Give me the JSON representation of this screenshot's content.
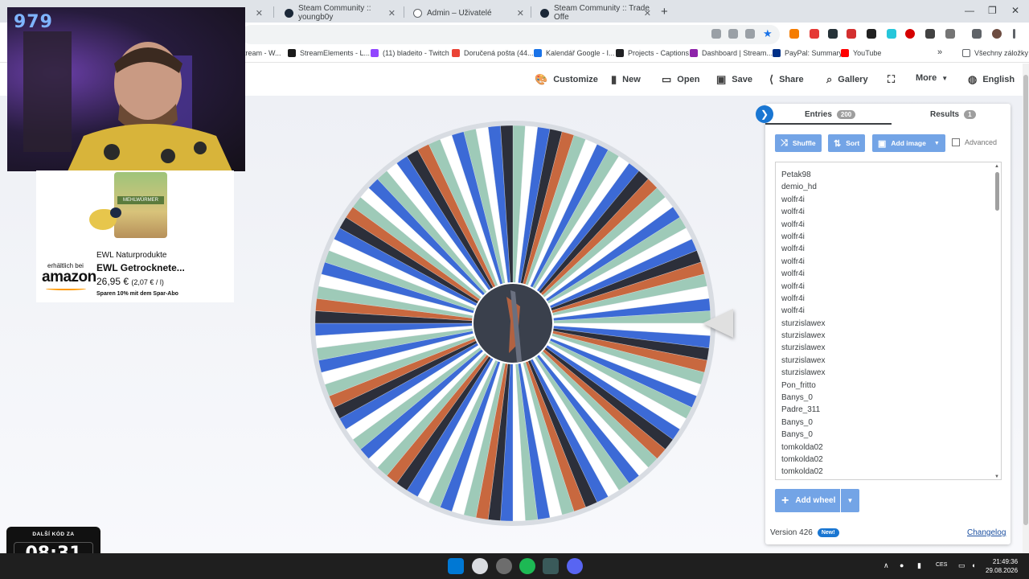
{
  "browser": {
    "tabs": [
      {
        "title": "Steam Community :: youngb0y"
      },
      {
        "title": "Admin – Uživatelé"
      },
      {
        "title": "Steam Community :: Trade Offe"
      }
    ],
    "bookmarks": [
      "tream - W...",
      "StreamElements - L...",
      "(11) bladeito - Twitch",
      "Doručená pošta (44...",
      "Kalendář Google - I...",
      "Projects - Captions",
      "Dashboard | Stream...",
      "PayPal: Summary",
      "YouTube",
      "Všechny záložky"
    ],
    "bookmark_more": "»"
  },
  "app_nav": {
    "customize": "Customize",
    "new": "New",
    "open": "Open",
    "save": "Save",
    "share": "Share",
    "gallery": "Gallery",
    "more": "More",
    "language": "English"
  },
  "panel": {
    "entries_tab": "Entries",
    "entries_count": "200",
    "results_tab": "Results",
    "results_count": "1",
    "shuffle": "Shuffle",
    "sort": "Sort",
    "add_image": "Add image",
    "advanced": "Advanced",
    "entries": [
      "Petak98",
      "demio_hd",
      "wolfr4i",
      "wolfr4i",
      "wolfr4i",
      "wolfr4i",
      "wolfr4i",
      "wolfr4i",
      "wolfr4i",
      "wolfr4i",
      "wolfr4i",
      "wolfr4i",
      "sturzislawex",
      "sturzislawex",
      "sturzislawex",
      "sturzislawex",
      "sturzislawex",
      "Pon_fritto",
      "Banys_0",
      "Padre_311",
      "Banys_0",
      "Banys_0",
      "tomkolda02",
      "tomkolda02",
      "tomkolda02"
    ],
    "add_wheel": "Add wheel",
    "version": "Version 426",
    "version_badge": "New!",
    "changelog": "Changelog"
  },
  "wheel": {
    "segment_count": 100,
    "colors": [
      "#9ecab8",
      "#ffffff",
      "#3c6ad6",
      "#2c2f3a",
      "#c8683f",
      "#9ecab8",
      "#ffffff",
      "#3c6ad6"
    ]
  },
  "webcam": {
    "viewer_count": "979"
  },
  "ad": {
    "pack_label": "MEHLWÜRMER",
    "available_at": "erhältlich bei",
    "amazon": "amazon",
    "brand": "EWL Naturprodukte",
    "title": "EWL Getrocknete...",
    "price": "26,95 €",
    "unit_price": "(2,07 € / l)",
    "subscribe": "Sparen 10% mit dem Spar-Abo"
  },
  "timer": {
    "label": "DALŠÍ KÓD ZA",
    "value": "08:31"
  },
  "taskbar": {
    "lang": "CES",
    "time": "21:49:36",
    "date": "29.08.2026"
  }
}
